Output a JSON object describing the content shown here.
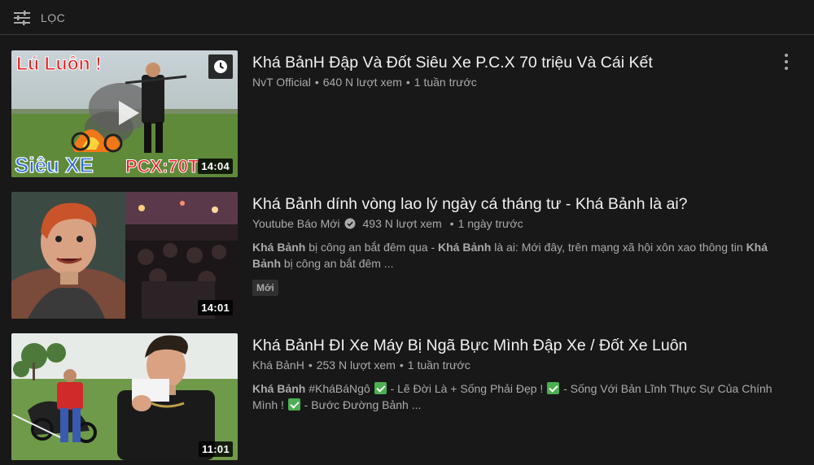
{
  "filter": {
    "label": "LỌC",
    "icon": "filter-sliders-icon"
  },
  "videos": [
    {
      "title": "Khá BảnH Đập Và Đốt Siêu Xe P.C.X 70 triệu Và Cái Kết",
      "channel": "NvT Official",
      "views": "640 N lượt xem",
      "age": "1 tuần trước",
      "duration": "14:04",
      "thumb_text_top": "Lú Luôn !",
      "thumb_text_left": "Siêu XE",
      "thumb_text_right": "PCX:70T",
      "verified": false
    },
    {
      "title": "Khá Bảnh dính vòng lao lý ngày cá tháng tư - Khá Bảnh là ai?",
      "channel": "Youtube Báo Mới",
      "views": "493 N lượt xem",
      "age": "1 ngày trước",
      "duration": "14:01",
      "verified": true,
      "desc": {
        "b1": "Khá Bảnh",
        "t1": " bị công an bắt đêm qua - ",
        "b2": "Khá Bảnh",
        "t2": " là ai: Mới đây, trên mạng xã hội xôn xao thông tin ",
        "b3": "Khá Bảnh",
        "t3": " bị công an bắt đêm ..."
      },
      "badge": "Mới"
    },
    {
      "title": "Khá BảnH ĐI Xe Máy Bị Ngã Bực Mình Đập Xe / Đốt Xe Luôn",
      "channel": "Khá BảnH",
      "views": "253 N lượt xem",
      "age": "1 tuần trước",
      "duration": "11:01",
      "verified": false,
      "desc": {
        "b1": "Khá Bảnh",
        "t1": " #KháBáNgô ",
        "t2": " - Lẽ Đời Là + Sống Phải Đẹp ! ",
        "t3": " - Sống Với Bản Lĩnh Thực Sự Của Chính Mình ! ",
        "t4": " - Bước Đường Bảnh ..."
      }
    }
  ],
  "separator": "•"
}
